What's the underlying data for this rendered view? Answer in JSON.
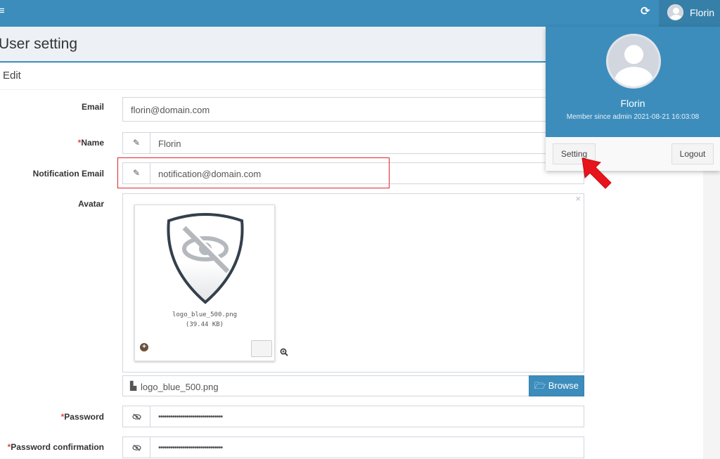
{
  "navbar": {
    "menu_icon": "hamburger-icon",
    "refresh_icon": "refresh-icon",
    "username": "Florin"
  },
  "header": {
    "title": "User setting",
    "subtitle": "Edit"
  },
  "form": {
    "email": {
      "label": "Email",
      "value": "florin@domain.com"
    },
    "name": {
      "required": "*",
      "label": "Name",
      "value": "Florin",
      "icon": "pencil-icon"
    },
    "notification_email": {
      "label": "Notification Email",
      "value": "notification@domain.com",
      "icon": "pencil-icon"
    },
    "avatar": {
      "label": "Avatar",
      "close": "×",
      "thumb_name": "logo_blue_500.png",
      "thumb_size": "(39.44 KB)",
      "caption": "logo_blue_500.png",
      "browse_label": "Browse"
    },
    "password": {
      "required": "*",
      "label": "Password",
      "value": "••••••••••••••••••••••••••••••••",
      "icon": "eye-slash-icon"
    },
    "password_confirmation": {
      "required": "*",
      "label": "Password confirmation",
      "value": "••••••••••••••••••••••••••••••••",
      "icon": "eye-slash-icon"
    }
  },
  "dropdown": {
    "name": "Florin",
    "member_since": "Member since admin 2021-08-21 16:03:08",
    "setting_label": "Setting",
    "logout_label": "Logout"
  },
  "colors": {
    "primary": "#3c8dbc",
    "primary_dark": "#367fa9",
    "required": "#dd4b39",
    "highlight": "#e0252b",
    "arrow": "#e8141b"
  }
}
